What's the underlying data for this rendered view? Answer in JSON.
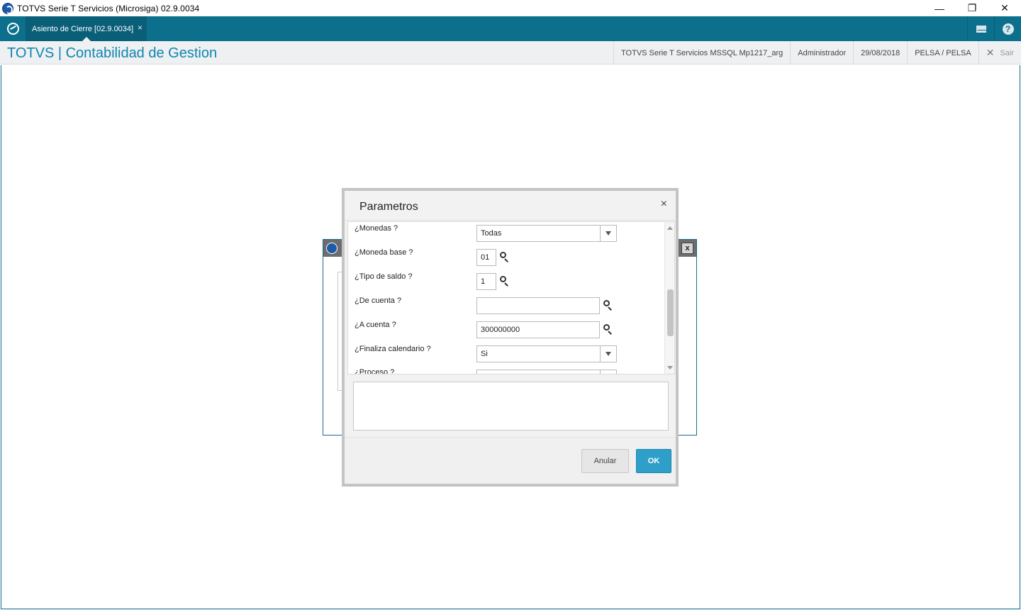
{
  "window": {
    "title": "TOTVS Serie T Servicios (Microsiga) 02.9.0034",
    "minimize_glyph": "—",
    "restore_glyph": "❐",
    "close_glyph": "✕"
  },
  "tabbar": {
    "active_tab": "Asiento de Cierre [02.9.0034]",
    "tab_close": "×",
    "help_glyph": "?",
    "accent_color": "#0c6f8c"
  },
  "header": {
    "brand": "TOTVS | Contabilidad de Gestion",
    "environment": "TOTVS Serie T Servicios MSSQL Mp1217_arg",
    "user": "Administrador",
    "date": "29/08/2018",
    "company": "PELSA / PELSA",
    "exit_glyph": "✕",
    "exit_label": "Sair"
  },
  "modal": {
    "title": "Parametros",
    "close_glyph": "×",
    "params": [
      {
        "label": "¿Monedas ?",
        "type": "select",
        "value": "Todas"
      },
      {
        "label": "¿Moneda base ?",
        "type": "lookup",
        "value": "01"
      },
      {
        "label": "¿Tipo de saldo ?",
        "type": "lookup",
        "value": "1"
      },
      {
        "label": "¿De cuenta ?",
        "type": "lookup",
        "value": ""
      },
      {
        "label": "¿A cuenta ?",
        "type": "lookup",
        "value": "300000000"
      },
      {
        "label": "¿Finaliza calendario ?",
        "type": "select",
        "value": "Si"
      },
      {
        "label": "¿Proceso ?",
        "type": "select",
        "value": ""
      }
    ],
    "cancel_label": "Anular",
    "ok_label": "OK",
    "ok_color": "#2e9fc9"
  },
  "icons": [
    "app-logo-icon",
    "home-icon",
    "mail-icon",
    "help-icon",
    "search-icon",
    "chevron-down-icon",
    "close-icon"
  ]
}
